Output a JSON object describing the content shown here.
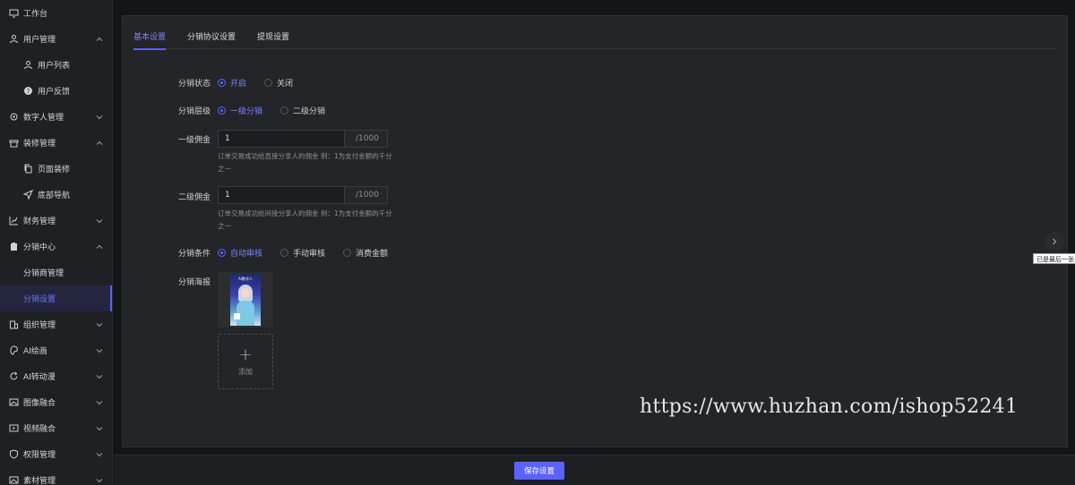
{
  "sidebar": {
    "items": [
      {
        "label": "工作台",
        "icon": "monitor-icon",
        "chevron": ""
      },
      {
        "label": "用户管理",
        "icon": "user-icon",
        "chevron": "up"
      },
      {
        "label": "用户列表",
        "icon": "user-icon",
        "chevron": "",
        "sub": true
      },
      {
        "label": "用户反馈",
        "icon": "question-icon",
        "chevron": "",
        "sub": true
      },
      {
        "label": "数字人管理",
        "icon": "gear-icon",
        "chevron": "down"
      },
      {
        "label": "装修管理",
        "icon": "shop-icon",
        "chevron": "up"
      },
      {
        "label": "页面装修",
        "icon": "copy-icon",
        "chevron": "",
        "sub": true
      },
      {
        "label": "底部导航",
        "icon": "send-icon",
        "chevron": "",
        "sub": true
      },
      {
        "label": "财务管理",
        "icon": "chart-icon",
        "chevron": "down"
      },
      {
        "label": "分销中心",
        "icon": "clipboard-icon",
        "chevron": "up"
      },
      {
        "label": "分销商管理",
        "icon": "",
        "chevron": "",
        "sub2": true
      },
      {
        "label": "分销设置",
        "icon": "",
        "chevron": "",
        "sub2": true,
        "active": true
      },
      {
        "label": "组织管理",
        "icon": "building-icon",
        "chevron": "down"
      },
      {
        "label": "AI绘画",
        "icon": "palette-icon",
        "chevron": "down"
      },
      {
        "label": "AI转动漫",
        "icon": "refresh-icon",
        "chevron": "down"
      },
      {
        "label": "图像融合",
        "icon": "image-icon",
        "chevron": "down"
      },
      {
        "label": "视频融合",
        "icon": "video-icon",
        "chevron": "down"
      },
      {
        "label": "权限管理",
        "icon": "shield-icon",
        "chevron": "down"
      },
      {
        "label": "素材管理",
        "icon": "image-icon",
        "chevron": "down"
      }
    ]
  },
  "tabs": [
    {
      "label": "基本设置",
      "active": true
    },
    {
      "label": "分销协议设置",
      "active": false
    },
    {
      "label": "提现设置",
      "active": false
    }
  ],
  "form": {
    "status": {
      "label": "分销状态",
      "options": [
        {
          "text": "开启",
          "on": true
        },
        {
          "text": "关闭",
          "on": false
        }
      ]
    },
    "level": {
      "label": "分销层级",
      "options": [
        {
          "text": "一级分销",
          "on": true
        },
        {
          "text": "二级分销",
          "on": false
        }
      ]
    },
    "commission1": {
      "label": "一级佣金",
      "value": "1",
      "suffix": "/1000",
      "hint": "订单交易成功给直接分享人的佣金 例：1为支付金额的千分之一"
    },
    "commission2": {
      "label": "二级佣金",
      "value": "1",
      "suffix": "/1000",
      "hint": "订单交易成功给间接分享人的佣金 例：1为支付金额的千分之一"
    },
    "condition": {
      "label": "分销条件",
      "options": [
        {
          "text": "自动审核",
          "on": true
        },
        {
          "text": "手动审核",
          "on": false
        },
        {
          "text": "消费金额",
          "on": false
        }
      ]
    },
    "poster": {
      "label": "分销海报",
      "poster_title": "AI数字人",
      "add_label": "添加"
    }
  },
  "watermark": "https://www.huzhan.com/ishop52241",
  "tooltip": "已是最后一张",
  "footer": {
    "save_label": "保存设置"
  },
  "colors": {
    "accent": "#5a63ff",
    "background": "#141517",
    "panel": "#242528"
  }
}
